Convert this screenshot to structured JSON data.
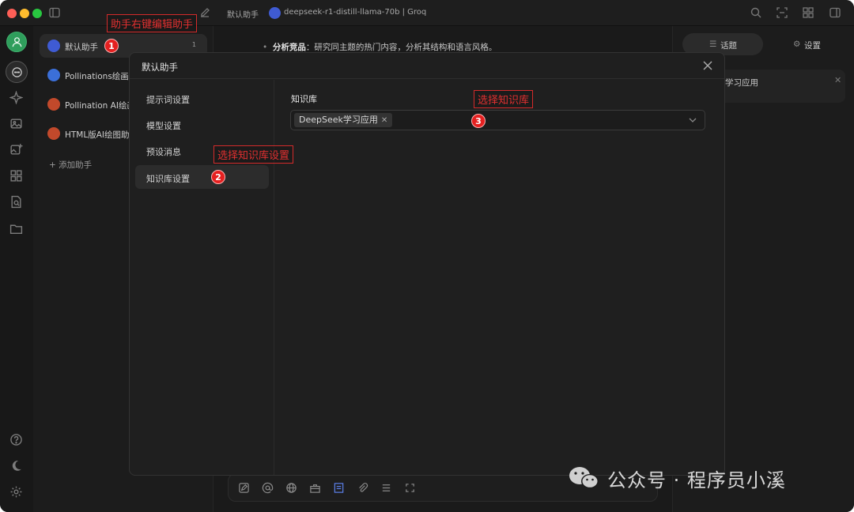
{
  "titlebar": {
    "left_title": "默认助手",
    "model": "deepseek-r1-distill-llama-70b | Groq"
  },
  "assistants": {
    "items": [
      {
        "label": "默认助手",
        "count": "1",
        "color": "#3f5bd3"
      },
      {
        "label": "Pollinations绘画",
        "color": "#3b6fd8"
      },
      {
        "label": "Pollination AI绘画",
        "color": "#c2492b"
      },
      {
        "label": "HTML版AI绘图助",
        "color": "#c2492b"
      }
    ],
    "add_label": "+ 添加助手"
  },
  "chat": {
    "line_bold": "分析竞品",
    "line_rest": "：研究同主题的热门内容，分析其结构和语言风格。"
  },
  "right_panel": {
    "tab_topics": "话题",
    "tab_settings": "设置",
    "topic_text": "学习应用"
  },
  "modal": {
    "title": "默认助手",
    "nav": [
      "提示词设置",
      "模型设置",
      "预设消息",
      "知识库设置"
    ],
    "kb_label": "知识库",
    "kb_tag": "DeepSeek学习应用"
  },
  "annotations": {
    "a1": "助手右键编辑助手",
    "a2": "选择知识库设置",
    "a3": "选择知识库",
    "n1": "1",
    "n2": "2",
    "n3": "3"
  },
  "watermark": "公众号 · 程序员小溪",
  "colors": {
    "accent_green": "#2f9e5c",
    "annotation_red": "#e52020"
  }
}
